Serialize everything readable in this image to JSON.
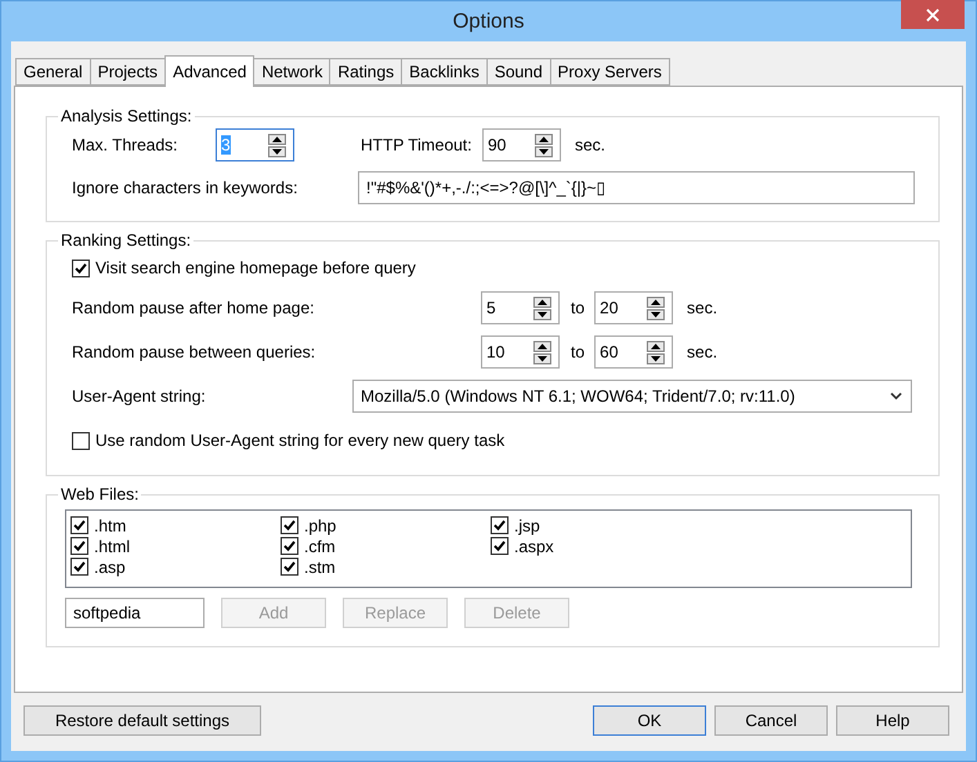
{
  "window": {
    "title": "Options"
  },
  "tabs": [
    {
      "label": "General",
      "selected": false
    },
    {
      "label": "Projects",
      "selected": false
    },
    {
      "label": "Advanced",
      "selected": true
    },
    {
      "label": "Network",
      "selected": false
    },
    {
      "label": "Ratings",
      "selected": false
    },
    {
      "label": "Backlinks",
      "selected": false
    },
    {
      "label": "Sound",
      "selected": false
    },
    {
      "label": "Proxy Servers",
      "selected": false
    }
  ],
  "analysis": {
    "title": "Analysis Settings:",
    "max_threads": {
      "label": "Max. Threads:",
      "value": "3",
      "focused": true
    },
    "http_timeout": {
      "label": "HTTP Timeout:",
      "value": "90",
      "unit": "sec.",
      "focused": false
    },
    "ignore_chars": {
      "label": "Ignore characters in keywords:",
      "value": "!\"#$%&'()*+,-./:;<=>?@[\\]^_`{|}~▯"
    }
  },
  "ranking": {
    "title": "Ranking Settings:",
    "visit_homepage": {
      "label": "Visit search engine homepage before query",
      "checked": true
    },
    "pause_rows": [
      {
        "label": "Random pause after home page:",
        "from": "5",
        "to_label": "to",
        "to": "20",
        "unit": "sec."
      },
      {
        "label": "Random pause between queries:",
        "from": "10",
        "to_label": "to",
        "to": "60",
        "unit": "sec."
      }
    ],
    "user_agent": {
      "label": "User-Agent string:",
      "value": "Mozilla/5.0 (Windows NT 6.1; WOW64; Trident/7.0; rv:11.0)"
    },
    "random_user_agent": {
      "label": "Use random User-Agent string for every new query task",
      "checked": false
    }
  },
  "web_files": {
    "title": "Web Files:",
    "extensions": [
      {
        "label": ".htm",
        "checked": true
      },
      {
        "label": ".php",
        "checked": true
      },
      {
        "label": ".jsp",
        "checked": true
      },
      {
        "label": ".html",
        "checked": true
      },
      {
        "label": ".cfm",
        "checked": true
      },
      {
        "label": ".aspx",
        "checked": true
      },
      {
        "label": ".asp",
        "checked": true
      },
      {
        "label": ".stm",
        "checked": true
      }
    ],
    "entry": {
      "value": "softpedia"
    },
    "buttons": [
      {
        "label": "Add",
        "disabled": true
      },
      {
        "label": "Replace",
        "disabled": true
      },
      {
        "label": "Delete",
        "disabled": true
      }
    ]
  },
  "footer": {
    "restore": {
      "label": "Restore default settings"
    },
    "buttons": [
      {
        "label": "OK",
        "default": true
      },
      {
        "label": "Cancel",
        "default": false
      },
      {
        "label": "Help",
        "default": false
      }
    ]
  }
}
